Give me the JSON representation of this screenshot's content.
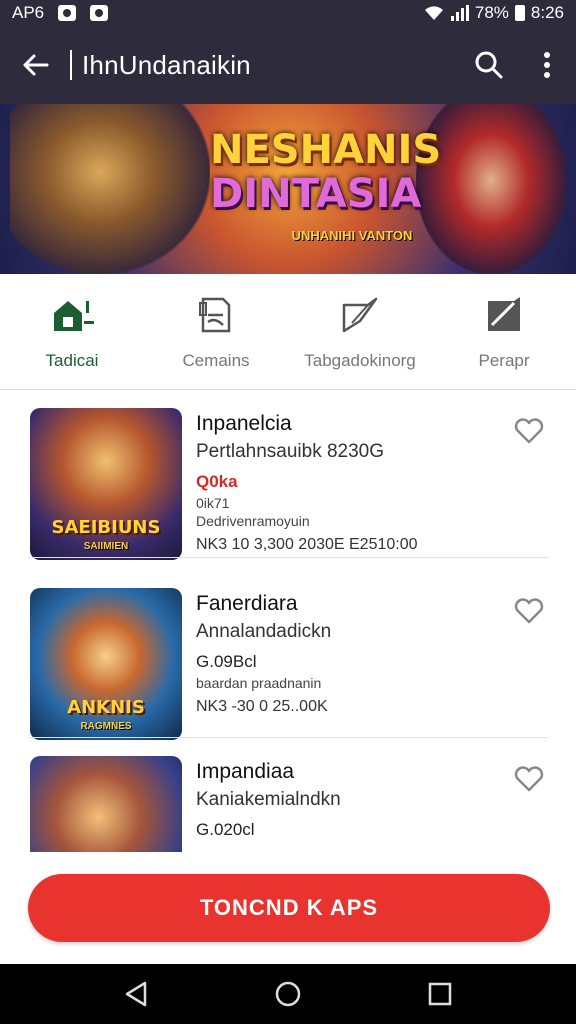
{
  "status_bar": {
    "carrier": "AP6",
    "battery_pct": "78%",
    "time": "8:26"
  },
  "app_bar": {
    "title": "IhnUndanaikin"
  },
  "banner": {
    "title_line1": "NESHANIS",
    "title_line2": "DINTASIA",
    "subtitle": "UNHANIHI VANTON"
  },
  "categories": [
    {
      "label": "Tadicai",
      "icon": "home-icon",
      "active": true
    },
    {
      "label": "Cemains",
      "icon": "book-icon",
      "active": false
    },
    {
      "label": "Tabgadokinorg",
      "icon": "leaf-icon",
      "active": false
    },
    {
      "label": "Perapr",
      "icon": "trend-icon",
      "active": false
    }
  ],
  "items": [
    {
      "title": "Inpanelcia",
      "subtitle": "Pertlahnsauibk 8230G",
      "price": "Q0ka",
      "price_note": "0ik71",
      "small": "Dedrivenramoyuin",
      "meta": "NK3 10 3,300 2030E E2510:00",
      "caption": "SAEIBIUNS",
      "caption2": "SAIIMIEN"
    },
    {
      "title": "Fanerdiara",
      "subtitle": "Annalandadickn",
      "price": "G.09Bcl",
      "price_note": "",
      "small": "baardan praadnanin",
      "meta": "NK3 -30 0 25..00K",
      "caption": "ANKNIS",
      "caption2": "RAGMNES"
    },
    {
      "title": "Impandiaa",
      "subtitle": "Kaniakemialndkn",
      "price": "G.020cl",
      "price_note": "",
      "small": "",
      "meta": "",
      "caption": "",
      "caption2": ""
    }
  ],
  "cta": {
    "label": "TONCND K APS"
  },
  "colors": {
    "bar_bg": "#2e2b3d",
    "accent_red": "#e8332e",
    "active_green": "#1b5e2f"
  }
}
